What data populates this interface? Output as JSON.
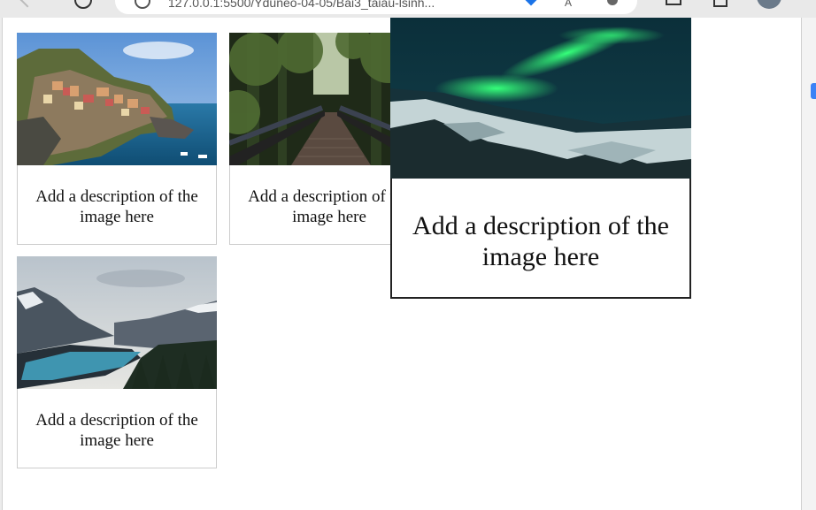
{
  "browser": {
    "url": "127.0.0.1:5500/Yduneo-04-05/Bai3_taiau-lsinh..."
  },
  "gallery": [
    {
      "image": "cinque-terre-coastal-village",
      "description": "Add a description of the image here"
    },
    {
      "image": "forest-bridge",
      "description": "Add a description of the image here"
    },
    {
      "image": "northern-lights",
      "description": "Add a description of the image here"
    },
    {
      "image": "mountain-lake",
      "description": "Add a description of the image here"
    }
  ],
  "colors": {
    "card_border": "#cccccc",
    "hover_border": "#222222",
    "text": "#111111"
  }
}
